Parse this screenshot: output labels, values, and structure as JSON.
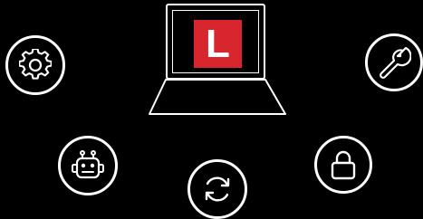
{
  "logo": {
    "letter": "L",
    "background_color": "#d7262d",
    "letter_color": "#ffffff"
  },
  "icons": [
    {
      "name": "gear-icon"
    },
    {
      "name": "robot-icon"
    },
    {
      "name": "refresh-icon"
    },
    {
      "name": "lock-icon"
    },
    {
      "name": "wrench-icon"
    }
  ],
  "colors": {
    "background": "#000000",
    "stroke": "#ffffff"
  }
}
